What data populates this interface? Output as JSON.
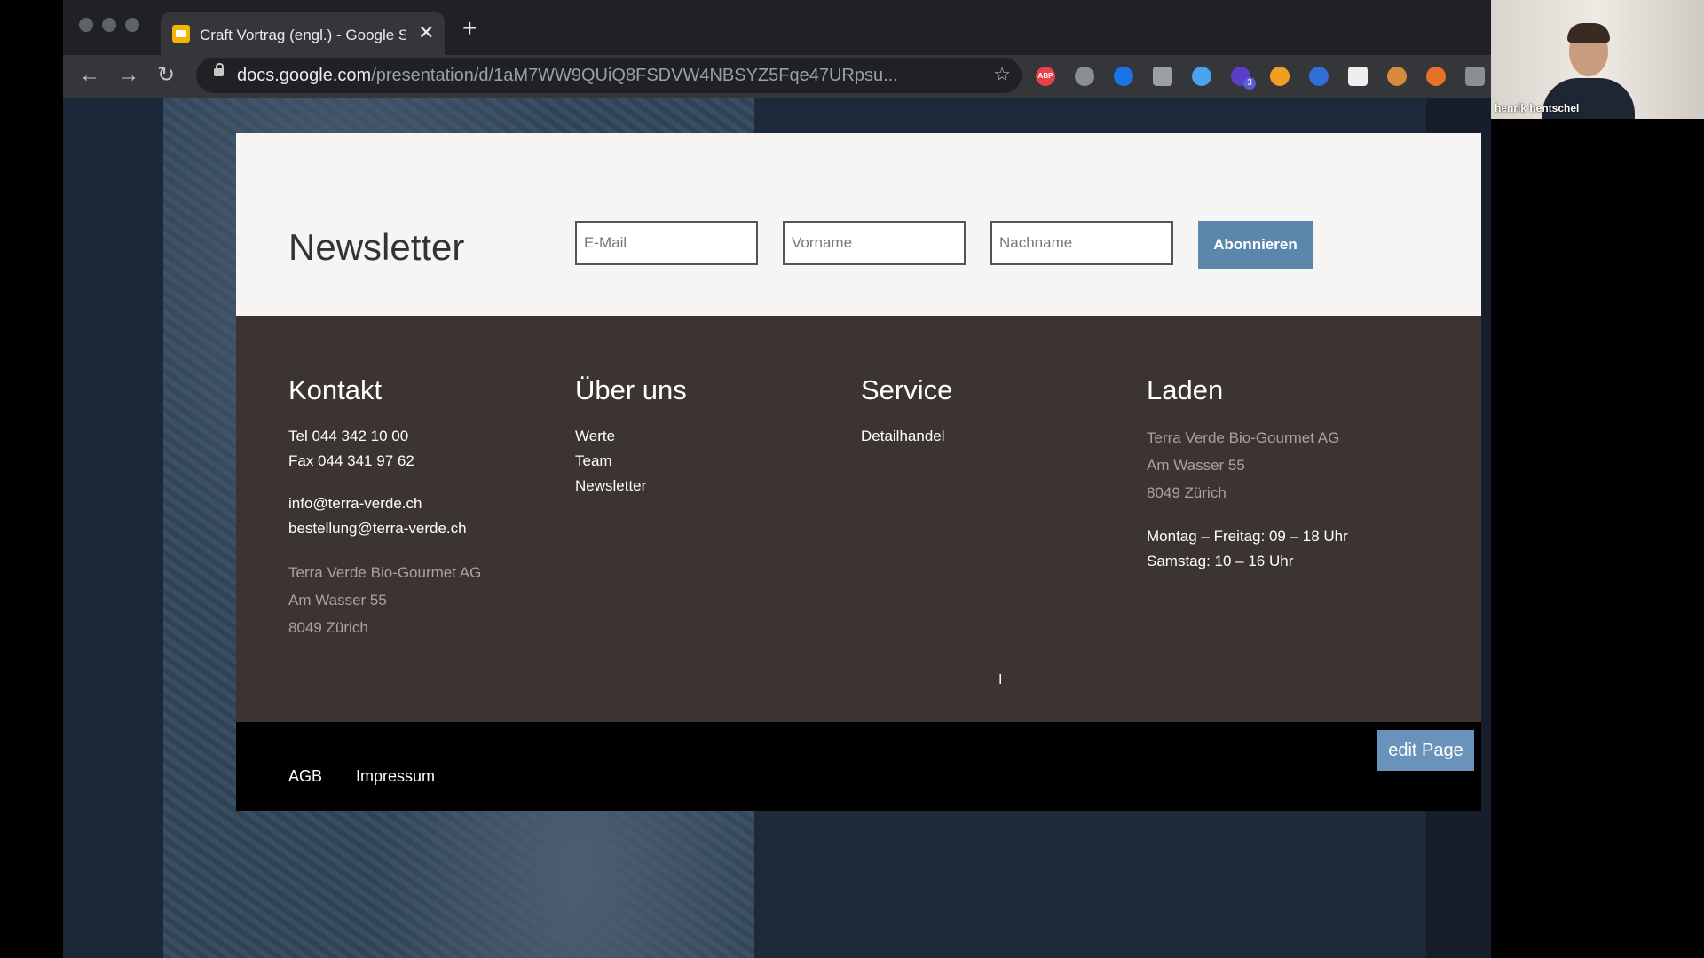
{
  "browser": {
    "tab_title": "Craft Vortrag (engl.) - Google Slides",
    "url_host": "docs.google.com",
    "url_path": "/presentation/d/1aM7WW9QUiQ8FSDVW4NBSYZ5Fqe47URpsu...",
    "new_tab_glyph": "+",
    "close_glyph": "✕",
    "back_glyph": "←",
    "forward_glyph": "→",
    "reload_glyph": "↻",
    "star_glyph": "☆",
    "ext_abp_label": "ABP",
    "ext_badge_count": "3"
  },
  "webcam": {
    "name": "henrik hentschel"
  },
  "newsletter": {
    "title": "Newsletter",
    "email_placeholder": "E-Mail",
    "firstname_placeholder": "Vorname",
    "lastname_placeholder": "Nachname",
    "subscribe_label": "Abonnieren"
  },
  "footer": {
    "kontakt": {
      "title": "Kontakt",
      "tel": "Tel 044 342 10 00",
      "fax": "Fax 044 341 97 62",
      "email_info": "info@terra-verde.ch",
      "email_order": "bestellung@terra-verde.ch",
      "company": "Terra Verde Bio-Gourmet AG",
      "street": "Am Wasser 55",
      "city": "8049 Zürich"
    },
    "ueber_uns": {
      "title": "Über uns",
      "links": [
        "Werte",
        "Team",
        "Newsletter"
      ]
    },
    "service": {
      "title": "Service",
      "links": [
        "Detailhandel"
      ]
    },
    "laden": {
      "title": "Laden",
      "company": "Terra Verde Bio-Gourmet AG",
      "street": "Am Wasser 55",
      "city": "8049 Zürich",
      "hours_week": "Montag – Freitag: 09 – 18 Uhr",
      "hours_sat": "Samstag: 10 – 16 Uhr"
    }
  },
  "subfooter": {
    "agb": "AGB",
    "impressum": "Impressum",
    "edit_label": "edit Page"
  },
  "colors": {
    "accent": "#5c87ad",
    "footer_bg": "#3b3431",
    "newsletter_bg": "#f6f5f3"
  }
}
